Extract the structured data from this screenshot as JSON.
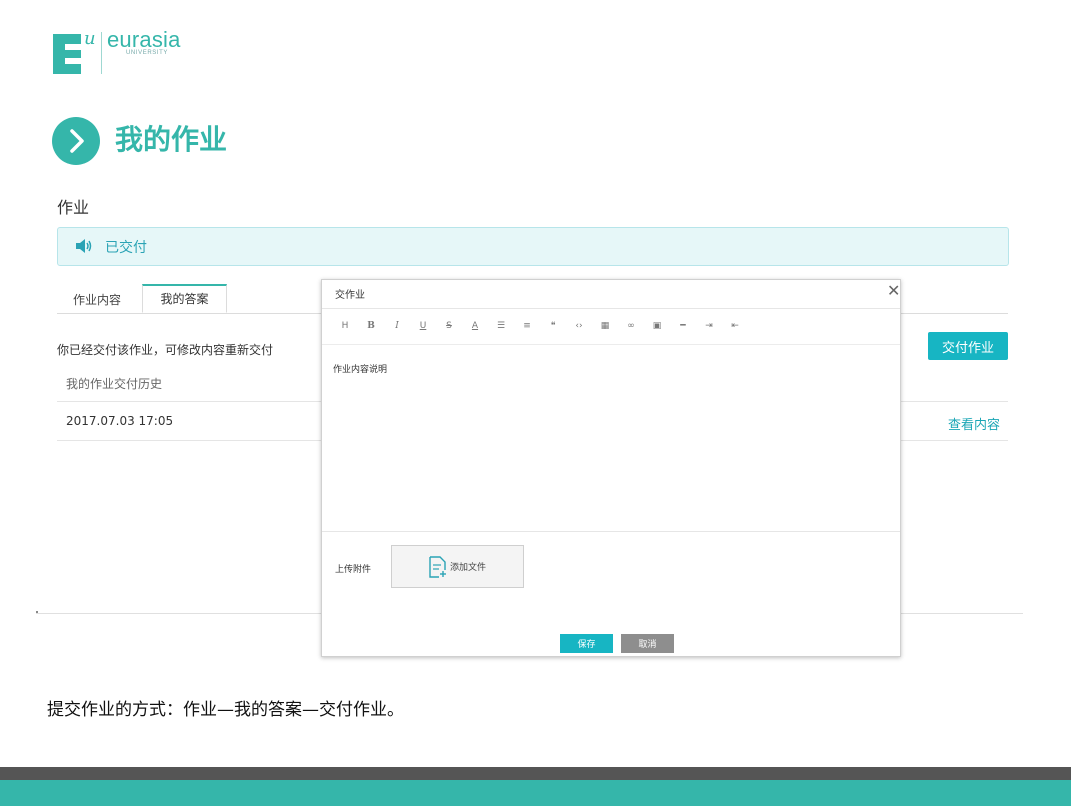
{
  "logo": {
    "letter": "E",
    "superscript": "u",
    "word": "eurasia",
    "sub": "UNIVERSITY"
  },
  "page": {
    "title": "我的作业",
    "section_label": "作业"
  },
  "notice": {
    "text": "已交付"
  },
  "tabs": [
    {
      "label": "作业内容"
    },
    {
      "label": "我的答案"
    }
  ],
  "answer": {
    "info": "你已经交付该作业，可修改内容重新交付",
    "history_label": "我的作业交付历史",
    "submit_label": "交付作业",
    "history": [
      {
        "date": "2017.07.03 17:05",
        "action": "查看内容"
      }
    ]
  },
  "modal": {
    "title": "交作业",
    "toolbar": [
      "H",
      "B",
      "I",
      "U",
      "S",
      "A",
      "ordered-list",
      "unordered-list",
      "quote",
      "code",
      "table",
      "link",
      "image",
      "hr",
      "indent",
      "outdent"
    ],
    "editor_placeholder": "作业内容说明",
    "upload_label": "上传附件",
    "add_file_label": "添加文件",
    "save_label": "保存",
    "cancel_label": "取消"
  },
  "caption": "提交作业的方式：作业—我的答案—交付作业。",
  "colors": {
    "brand": "#35b6aa",
    "button": "#17b5c3",
    "footer_dark": "#555555"
  }
}
